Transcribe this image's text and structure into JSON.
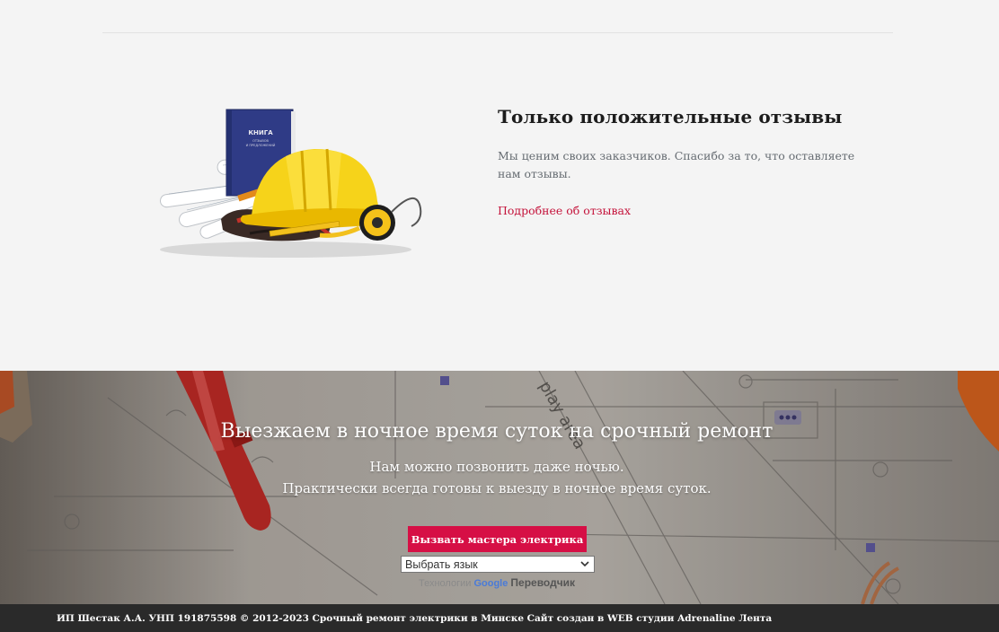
{
  "reviews": {
    "title": "Только положительные отзывы",
    "text": "Мы ценим своих заказчиков. Спасибо за то, что оставляете нам отзывы.",
    "link_label": "Подробнее об отзывах",
    "book_title": "КНИГА",
    "book_subtitle_1": "ОТЗЫВОВ",
    "book_subtitle_2": "И ПРЕДЛОЖЕНИЙ"
  },
  "night": {
    "title": "Выезжаем в ночное время суток на срочный ремонт",
    "line1": "Нам можно позвонить даже ночью.",
    "line2": "Практически всегда готовы к выезду в ночное время суток.",
    "cta_label": "Вызвать мастера электрика",
    "language_select": "Выбрать язык",
    "powered_prefix": "Технологии",
    "google": "Google",
    "translator": "Переводчик",
    "blueprint_text": "play area"
  },
  "footer": {
    "copyright": "ИП Шестак А.А. УНП 191875598 © 2012-2023 Срочный ремонт электрики в Минске Сайт создан в WEB студии Adrenaline Лента"
  },
  "colors": {
    "accent": "#d60f45",
    "link": "#c4123a",
    "footer_bg": "#2a2a2a",
    "section_bg": "#f4f4f4"
  }
}
